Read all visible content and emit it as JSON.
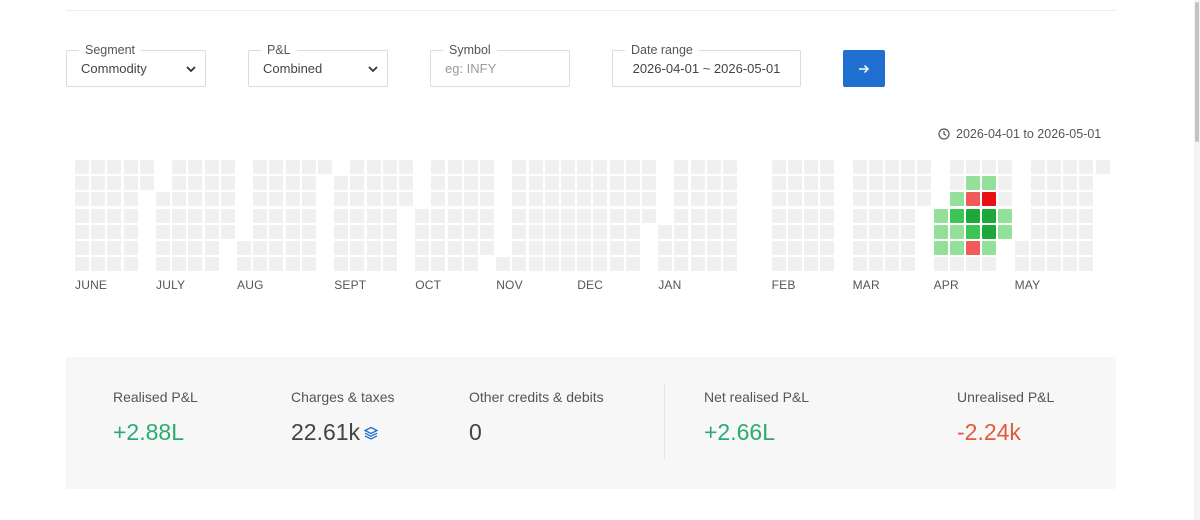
{
  "filters": {
    "segment": {
      "label": "Segment",
      "value": "Commodity"
    },
    "pnl": {
      "label": "P&L",
      "value": "Combined"
    },
    "symbol": {
      "label": "Symbol",
      "placeholder": "eg: INFY"
    },
    "date_range": {
      "label": "Date range",
      "value": "2026-04-01 ~ 2026-05-01"
    }
  },
  "range_note": "2026-04-01 to 2026-05-01",
  "heatmap": {
    "months": [
      "JUNE",
      "JULY",
      "AUG",
      "SEPT",
      "OCT",
      "NOV",
      "DEC",
      "JAN",
      "FEB",
      "MAR",
      "APR",
      "MAY"
    ],
    "colors": {
      "empty": "#f0f0f0",
      "profit_light": "#93e09a",
      "profit": "#3cc454",
      "profit_dark": "#1ea83c",
      "loss": "#f05a5a",
      "loss_dark": "#e81010"
    },
    "april_values": [
      [
        0,
        1,
        1,
        1,
        1
      ],
      [
        0,
        1,
        2,
        1,
        1
      ],
      [
        1,
        -1,
        3,
        2,
        -1
      ],
      [
        1,
        -2,
        3,
        3,
        1
      ],
      [
        0,
        0,
        1,
        1,
        0
      ]
    ]
  },
  "summary": {
    "realised": {
      "label": "Realised P&L",
      "value": "+2.88L"
    },
    "charges": {
      "label": "Charges & taxes",
      "value": "22.61k"
    },
    "other": {
      "label": "Other credits & debits",
      "value": "0"
    },
    "net": {
      "label": "Net realised P&L",
      "value": "+2.66L"
    },
    "unrealised": {
      "label": "Unrealised P&L",
      "value": "-2.24k"
    }
  }
}
